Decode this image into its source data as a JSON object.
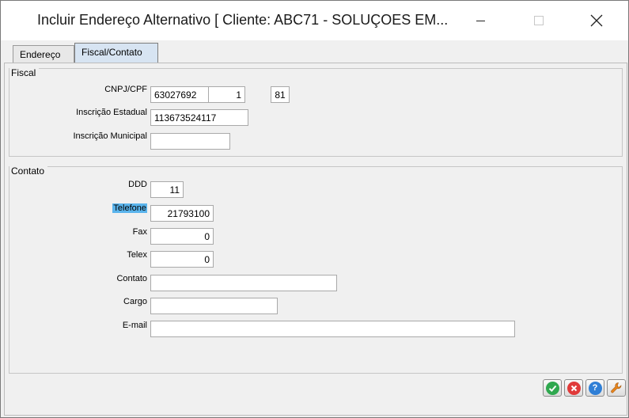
{
  "window": {
    "title": "Incluir Endereço Alternativo  [ Cliente: ABC71 - SOLUÇOES EM..."
  },
  "tabs": [
    {
      "label": "Endereço",
      "active": false
    },
    {
      "label": "Fiscal/Contato",
      "active": true
    }
  ],
  "fiscal": {
    "group_title": "Fiscal",
    "cnpj_label": "CNPJ/CPF",
    "cnpj_base": "63027692",
    "cnpj_filial": "1",
    "cnpj_dv": "81",
    "ie_label": "Inscrição Estadual",
    "ie_value": "113673524117",
    "im_label": "Inscrição Municipal",
    "im_value": ""
  },
  "contato": {
    "group_title": "Contato",
    "ddd_label": "DDD",
    "ddd_value": "11",
    "telefone_label": "Telefone",
    "telefone_value": "21793100",
    "fax_label": "Fax",
    "fax_value": "0",
    "telex_label": "Telex",
    "telex_value": "0",
    "contato_label": "Contato",
    "contato_value": "",
    "cargo_label": "Cargo",
    "cargo_value": "",
    "email_label": "E-mail",
    "email_value": ""
  },
  "buttons": [
    {
      "name": "confirm-icon",
      "color": "#2fa84f"
    },
    {
      "name": "cancel-icon",
      "color": "#e03a3a"
    },
    {
      "name": "help-icon",
      "color": "#2f7fd6"
    },
    {
      "name": "wrench-icon",
      "color": "#e8871e"
    }
  ]
}
